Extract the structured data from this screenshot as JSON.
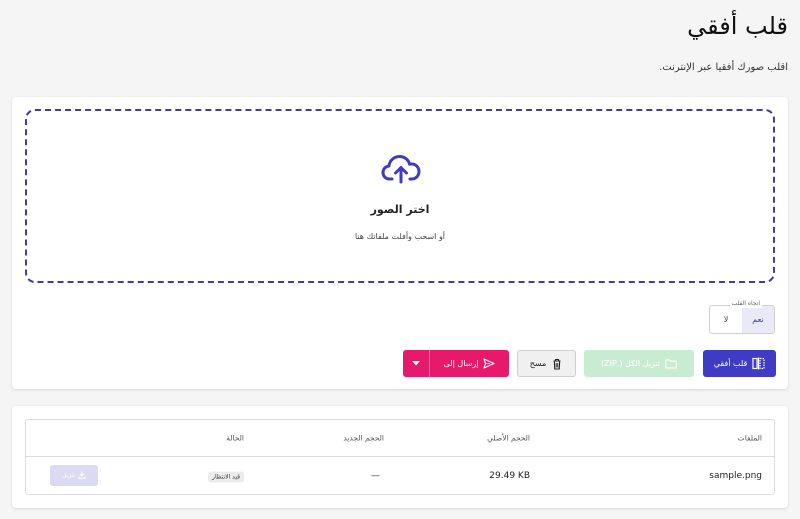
{
  "page": {
    "title": "قلب أفقي",
    "subtitle": "اقلب صورك أفقيا عبر الإنترنت."
  },
  "dropzone": {
    "title": "اختر الصور",
    "hint": "أو اسحب وأفلت ملفاتك هنا",
    "icon": "cloud-upload-icon"
  },
  "direction": {
    "legend": "اتجاه القلب",
    "options": [
      "نعم",
      "لا"
    ],
    "selected": "نعم"
  },
  "actions": {
    "flip_label": "قلب أفقي",
    "zip_label": "تنزيل الكل (.ZIP)",
    "clear_label": "مسح",
    "send_label": "إرسال إلى"
  },
  "table": {
    "headers": {
      "files": "الملفات",
      "original_size": "الحجم الأصلي",
      "new_size": "الحجم الجديد",
      "status": "الحالة"
    },
    "rows": [
      {
        "file": "sample.png",
        "original_size": "29.49 KB",
        "new_size": "—",
        "status": "قيد الانتظار",
        "download_label": "تنزيل"
      }
    ]
  },
  "colors": {
    "primary": "#3f3bc4",
    "accent": "#e6196a",
    "zip_disabled": "#c8ecd2",
    "dropzone_border": "#3f3d9e"
  }
}
